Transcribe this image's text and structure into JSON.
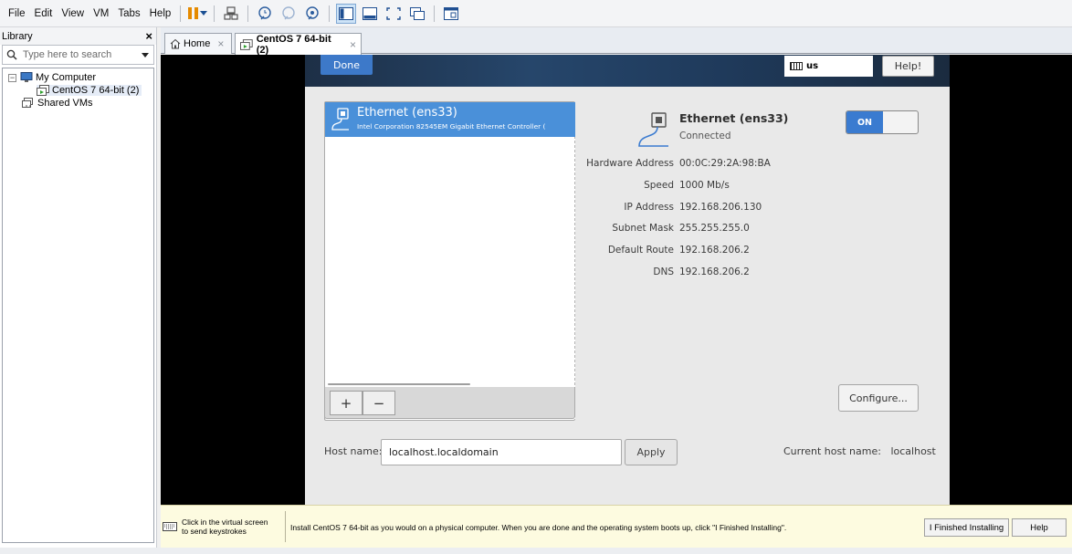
{
  "menubar": {
    "items": [
      "File",
      "Edit",
      "View",
      "VM",
      "Tabs",
      "Help"
    ]
  },
  "library": {
    "title": "Library",
    "search_placeholder": "Type here to search",
    "tree": {
      "my_computer": "My Computer",
      "vm": "CentOS 7 64-bit (2)",
      "shared": "Shared VMs"
    }
  },
  "tabs": [
    {
      "label": "Home"
    },
    {
      "label": "CentOS 7 64-bit (2)"
    }
  ],
  "anaconda": {
    "done_label": "Done",
    "keyboard_layout": "us",
    "help_label": "Help!",
    "interface_name": "Ethernet (ens33)",
    "interface_desc": "Intel Corporation 82545EM Gigabit Ethernet Controller (",
    "add_label": "+",
    "remove_label": "−",
    "detail": {
      "title": "Ethernet (ens33)",
      "status": "Connected",
      "toggle": "ON",
      "fields": [
        {
          "label": "Hardware Address",
          "value": "00:0C:29:2A:98:BA"
        },
        {
          "label": "Speed",
          "value": "1000 Mb/s"
        },
        {
          "label": "IP Address",
          "value": "192.168.206.130"
        },
        {
          "label": "Subnet Mask",
          "value": "255.255.255.0"
        },
        {
          "label": "Default Route",
          "value": "192.168.206.2"
        },
        {
          "label": "DNS",
          "value": "192.168.206.2"
        }
      ],
      "configure_label": "Configure..."
    },
    "host_label": "Host name:",
    "host_value": "localhost.localdomain",
    "apply_label": "Apply",
    "current_host_label": "Current host name:",
    "current_host_value": "localhost"
  },
  "hintbar": {
    "click_line1": "Click in the virtual screen",
    "click_line2": "to send keystrokes",
    "message": "Install CentOS 7 64-bit as you would on a physical computer. When you are done and the operating system boots up, click \"I Finished Installing\".",
    "finished_label": "I Finished Installing",
    "help_label": "Help"
  },
  "colors": {
    "accent": "#4a90d9",
    "done": "#3d79c9",
    "toggle_on": "#3a7bd0",
    "pause": "#e58a00",
    "hint_bg": "#fdfbe0"
  }
}
